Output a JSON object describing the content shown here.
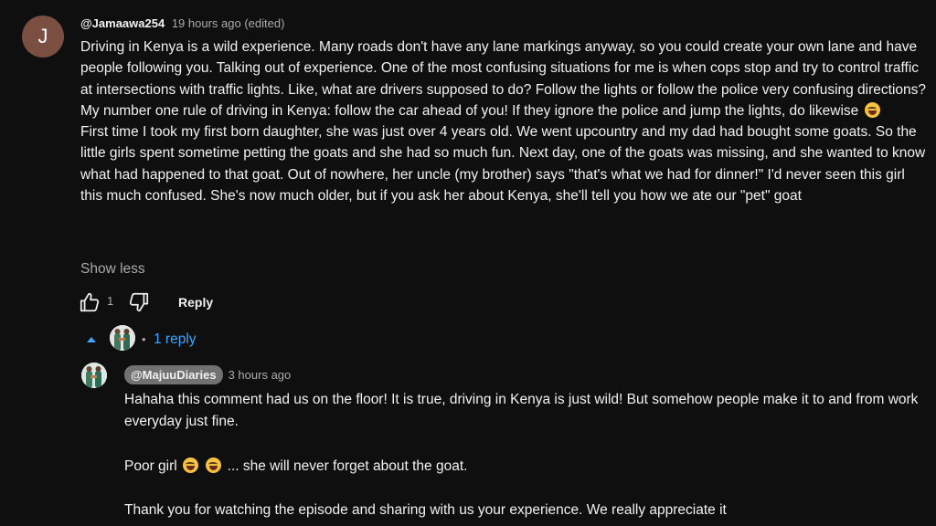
{
  "comment": {
    "avatar_letter": "J",
    "author": "@Jamaawa254",
    "meta": "19 hours ago (edited)",
    "paragraphs": {
      "p1": "Driving in Kenya is a wild experience. Many roads don't have any lane markings anyway, so you could create your own lane and have people following you. Talking out of experience. One of the most confusing situations for me is when cops stop and try to control traffic at intersections with traffic lights. Like, what are drivers supposed to do? Follow the lights or follow the police very confusing directions? My number one rule of driving in Kenya: follow the car ahead of you! If they ignore the police and jump the lights, do likewise",
      "p2": "First time I took my first born daughter, she was just over 4 years old. We went upcountry and my dad had bought some goats. So the little girls spent sometime petting the goats and she had so much fun. Next day, one of the goats was missing, and she wanted to know what had happened to that goat. Out of nowhere, her uncle (my brother) says \"that's what we had for dinner!\" I'd never seen this girl this much confused. She's now much older, but if you ask her about Kenya, she'll tell you how we ate our \"pet\" goat"
    },
    "emoji_p1": "rolling-on-floor-laughing-emoji",
    "show_less": "Show less",
    "like_count": "1",
    "reply_label": "Reply",
    "replies_toggle": "1 reply"
  },
  "reply": {
    "author": "@MajuuDiaries",
    "time": "3 hours ago",
    "r1": "Hahaha this comment had us on the floor! It is true, driving in Kenya is just wild! But somehow people make it to and from work everyday just fine.",
    "r2_before": "Poor girl",
    "r2_after": "... she will never forget about the goat.",
    "r3": "Thank you for watching the episode and sharing with us your experience.  We really appreciate it"
  },
  "colors": {
    "background": "#0f0f0f",
    "text": "#f1f1f1",
    "muted": "#aaaaaa",
    "link": "#3ea6ff",
    "avatar": "#7a4e40",
    "channel_badge": "#717171"
  }
}
